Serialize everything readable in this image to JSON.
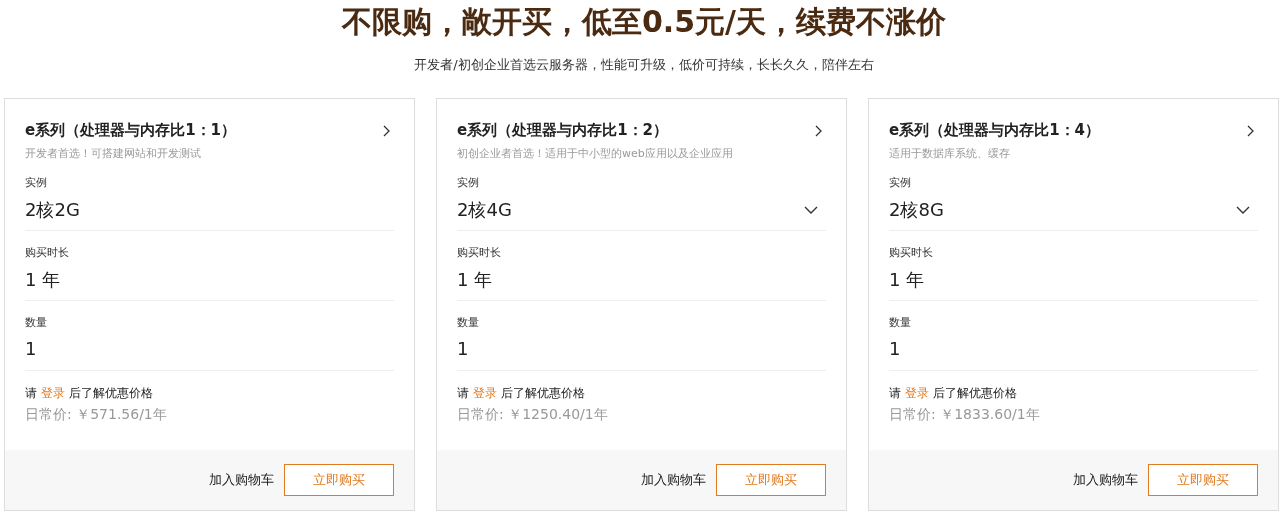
{
  "heading": "不限购，敞开买，低至0.5元/天，续费不涨价",
  "subheading": "开发者/初创企业首选云服务器，性能可升级，低价可持续，长长久久，陪伴左右",
  "cards": [
    {
      "title": "e系列（处理器与内存比1：1）",
      "subtitle": "开发者首选！可搭建网站和开发测试",
      "fields": [
        {
          "label": "实例",
          "value": "2核2G",
          "dropdown": false
        },
        {
          "label": "购买时长",
          "value": "1 年",
          "dropdown": false
        },
        {
          "label": "数量",
          "value": "1",
          "dropdown": false
        }
      ],
      "login_prompt": {
        "before": "请",
        "link": "登录",
        "after": "后了解优惠价格"
      },
      "price": "日常价: ￥571.56/1年",
      "cart_button": "加入购物车",
      "buy_button": "立即购买"
    },
    {
      "title": "e系列（处理器与内存比1：2）",
      "subtitle": "初创企业者首选！适用于中小型的web应用以及企业应用",
      "fields": [
        {
          "label": "实例",
          "value": "2核4G",
          "dropdown": true
        },
        {
          "label": "购买时长",
          "value": "1 年",
          "dropdown": false
        },
        {
          "label": "数量",
          "value": "1",
          "dropdown": false
        }
      ],
      "login_prompt": {
        "before": "请",
        "link": "登录",
        "after": "后了解优惠价格"
      },
      "price": "日常价: ￥1250.40/1年",
      "cart_button": "加入购物车",
      "buy_button": "立即购买"
    },
    {
      "title": "e系列（处理器与内存比1：4）",
      "subtitle": "适用于数据库系统、缓存",
      "fields": [
        {
          "label": "实例",
          "value": "2核8G",
          "dropdown": true
        },
        {
          "label": "购买时长",
          "value": "1 年",
          "dropdown": false
        },
        {
          "label": "数量",
          "value": "1",
          "dropdown": false
        }
      ],
      "login_prompt": {
        "before": "请",
        "link": "登录",
        "after": "后了解优惠价格"
      },
      "price": "日常价: ￥1833.60/1年",
      "cart_button": "加入购物车",
      "buy_button": "立即购买"
    }
  ]
}
